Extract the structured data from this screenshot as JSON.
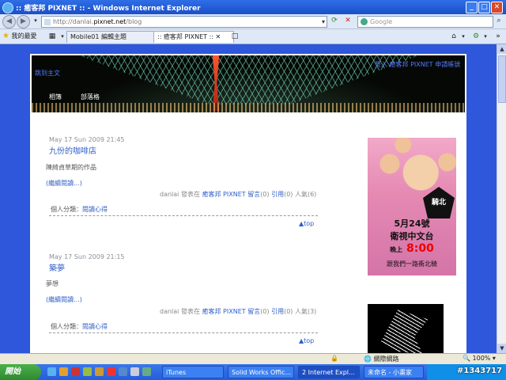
{
  "window": {
    "title": ":: 癒客邦 PIXNET :: - Windows Internet Explorer"
  },
  "addressbar": {
    "url_host": "http://danlai.",
    "url_domain": "pixnet.net",
    "url_path": "/blog",
    "search_placeholder": "Google"
  },
  "favorites_label": "我的最愛",
  "tabs": [
    {
      "label": "Mobile01 編輯主題"
    },
    {
      "label": ":: 癒客邦 PIXNET ::"
    }
  ],
  "banner": {
    "skip": "跳到主文",
    "top_links": "登入 癒客邦 PIXNET 申請帳號",
    "nav": [
      "相簿",
      "部落格"
    ]
  },
  "posts": [
    {
      "date": "May 17 Sun 2009 21:45",
      "title": "九份的咖啡店",
      "excerpt": "陳綺貞草期的作品",
      "readmore": "(繼續閱讀...)",
      "meta_author": "danlai 發表在",
      "meta_site": "癒客邦 PIXNET",
      "meta_comments": "留言",
      "meta_comments_n": "(0)",
      "meta_trackback": "引用",
      "meta_trackback_n": "(0)",
      "meta_views": "人氣(6)",
      "category_label": "個人分類：",
      "category": "閱讀心得",
      "top": "▲top"
    },
    {
      "date": "May 17 Sun 2009 21:15",
      "title": "築夢",
      "excerpt": "夢想",
      "readmore": "(繼續閱讀...)",
      "meta_author": "danlai 發表在",
      "meta_site": "癒客邦 PIXNET",
      "meta_comments": "留言",
      "meta_comments_n": "(0)",
      "meta_trackback": "引用",
      "meta_trackback_n": "(0)",
      "meta_views": "人氣(3)",
      "category_label": "個人分類：",
      "category": "閱讀心得",
      "top": "▲top"
    }
  ],
  "ad": {
    "badge": "騎北",
    "date_line": "5月24號",
    "channel": "衛視中文台",
    "time_prefix": "晚上",
    "time": "8:00",
    "tagline": "跟我們一路衝北騎"
  },
  "statusbar": {
    "zone": "網際網路",
    "zoom": "100%"
  },
  "taskbar": {
    "start": "開始",
    "tasks": [
      "iTunes",
      "Solid Works Offic...",
      "2 Internet Expl...",
      "未命名 - 小畫家"
    ]
  },
  "watermark": "#1343717"
}
